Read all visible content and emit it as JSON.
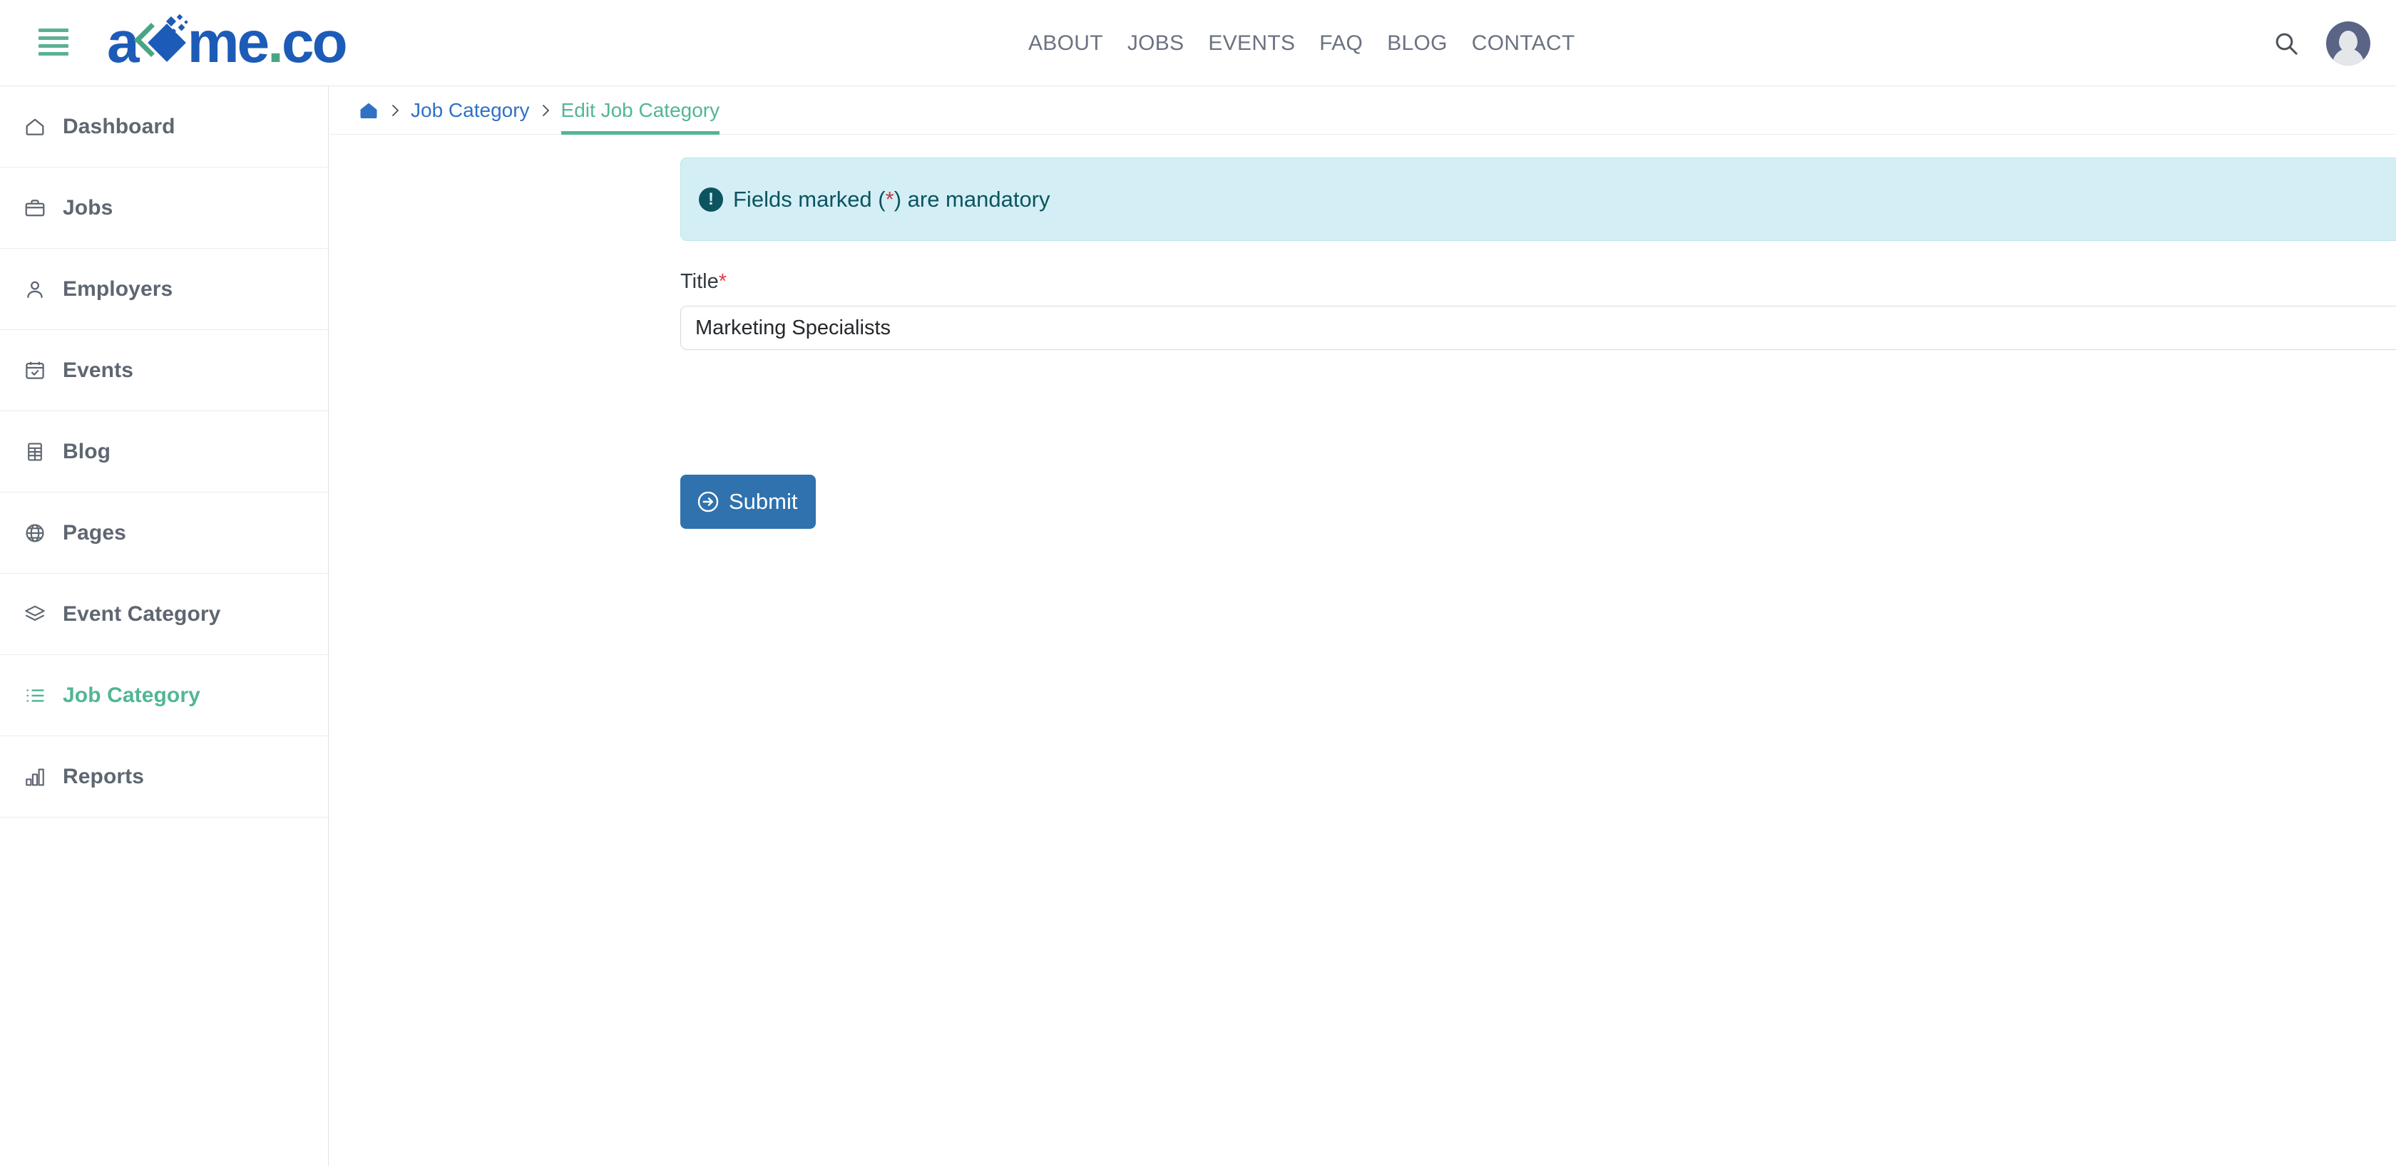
{
  "header": {
    "menu_toggle": "menu-toggle",
    "logo": {
      "part_a": "a",
      "part_rest": "me",
      "dot": ".",
      "tld": "co",
      "full_text": "acme.co"
    },
    "nav": [
      {
        "label": "ABOUT"
      },
      {
        "label": "JOBS"
      },
      {
        "label": "EVENTS"
      },
      {
        "label": "FAQ"
      },
      {
        "label": "BLOG"
      },
      {
        "label": "CONTACT"
      }
    ],
    "search_label": "search-icon",
    "avatar_label": "user-avatar"
  },
  "sidebar": {
    "items": [
      {
        "label": "Dashboard",
        "icon": "home-icon",
        "active": false
      },
      {
        "label": "Jobs",
        "icon": "briefcase-icon",
        "active": false
      },
      {
        "label": "Employers",
        "icon": "user-icon",
        "active": false
      },
      {
        "label": "Events",
        "icon": "calendar-icon",
        "active": false
      },
      {
        "label": "Blog",
        "icon": "table-icon",
        "active": false
      },
      {
        "label": "Pages",
        "icon": "globe-icon",
        "active": false
      },
      {
        "label": "Event Category",
        "icon": "layers-icon",
        "active": false
      },
      {
        "label": "Job Category",
        "icon": "list-icon",
        "active": true
      },
      {
        "label": "Reports",
        "icon": "bar-chart-icon",
        "active": false
      }
    ]
  },
  "breadcrumb": {
    "home": "home-icon",
    "separator": "›",
    "items": [
      {
        "label": "Job Category",
        "current": false
      },
      {
        "label": "Edit Job Category",
        "current": true
      }
    ]
  },
  "alert": {
    "icon": "exclamation-icon",
    "prefix": "Fields marked (",
    "star": "*",
    "suffix": ") are mandatory",
    "full_text": "Fields marked (*) are mandatory"
  },
  "form": {
    "title_label": "Title",
    "required_marker": "*",
    "title_value": "Marketing Specialists",
    "title_placeholder": "Title",
    "submit_label": "Submit"
  },
  "colors": {
    "brand_blue": "#1d5bb8",
    "brand_green": "#52b695",
    "link_blue": "#2f72c4",
    "alert_bg": "#d3eff5",
    "alert_text": "#0c5460",
    "required_red": "#e03c4a",
    "button_blue": "#2f72ad",
    "sidebar_text": "#5e6671"
  }
}
